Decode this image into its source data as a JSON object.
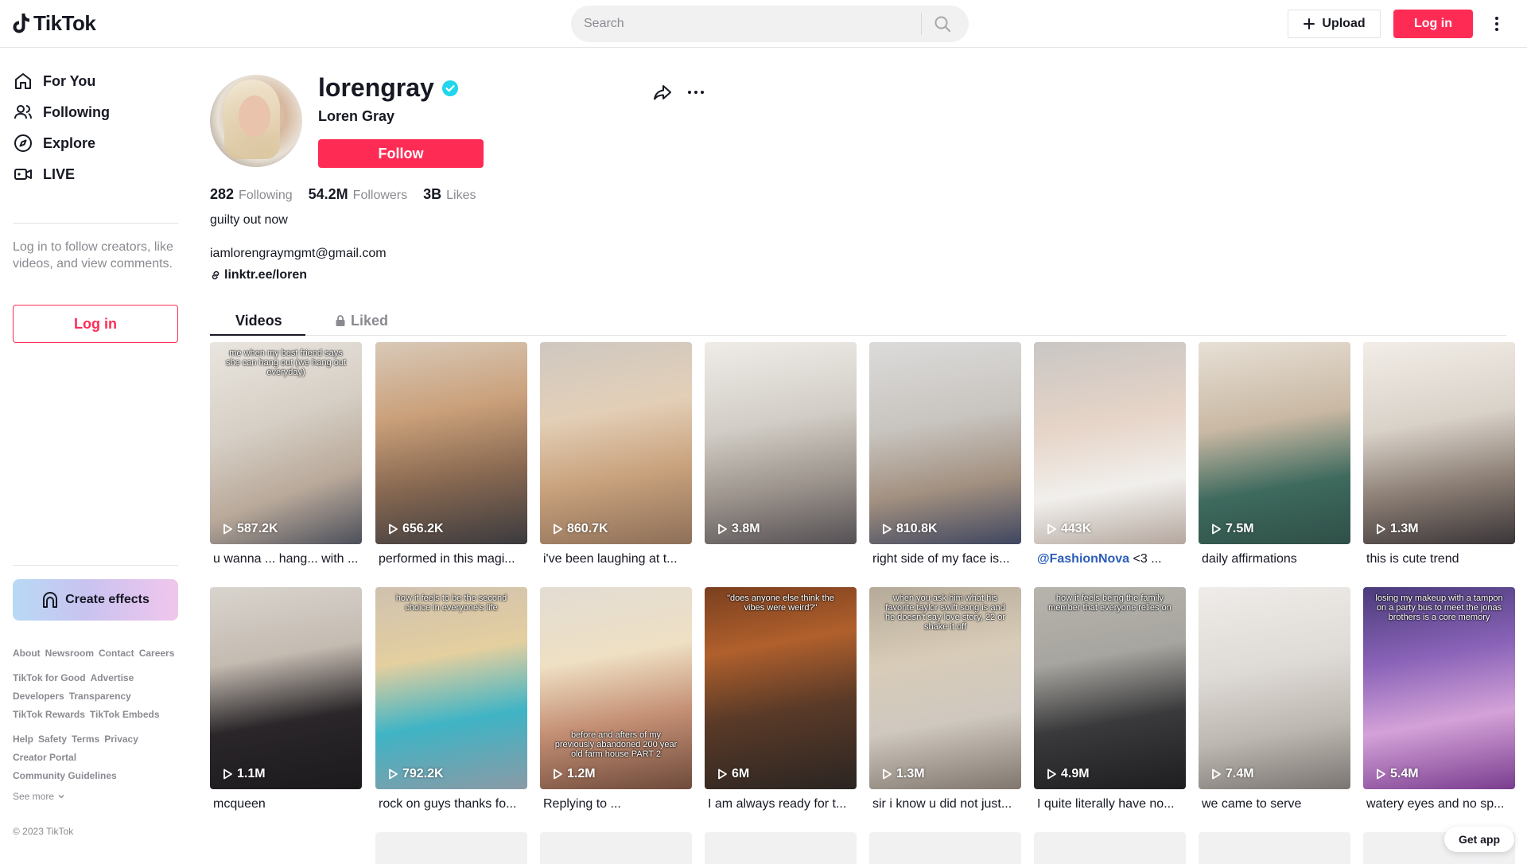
{
  "header": {
    "logo_text": "TikTok",
    "search_placeholder": "Search",
    "upload_label": "Upload",
    "login_label": "Log in"
  },
  "sidebar": {
    "items": [
      {
        "label": "For You",
        "icon": "home-icon"
      },
      {
        "label": "Following",
        "icon": "users-icon"
      },
      {
        "label": "Explore",
        "icon": "compass-icon"
      },
      {
        "label": "LIVE",
        "icon": "live-icon"
      }
    ],
    "login_hint": "Log in to follow creators, like videos, and view comments.",
    "login_label": "Log in",
    "create_effects_label": "Create effects",
    "footer_rows": [
      [
        "About",
        "Newsroom",
        "Contact",
        "Careers"
      ],
      [
        "TikTok for Good",
        "Advertise"
      ],
      [
        "Developers",
        "Transparency"
      ],
      [
        "TikTok Rewards",
        "TikTok Embeds"
      ],
      [
        "Help",
        "Safety",
        "Terms",
        "Privacy"
      ],
      [
        "Creator Portal"
      ],
      [
        "Community Guidelines"
      ]
    ],
    "see_more": "See more",
    "copyright": "© 2023 TikTok"
  },
  "profile": {
    "username": "lorengray",
    "nickname": "Loren Gray",
    "follow_label": "Follow",
    "following_count": "282",
    "following_label": "Following",
    "followers_count": "54.2M",
    "followers_label": "Followers",
    "likes_count": "3B",
    "likes_label": "Likes",
    "bio": "guilty out now",
    "email": "iamlorengraymgmt@gmail.com",
    "link": "linktr.ee/loren"
  },
  "tabs": {
    "videos": "Videos",
    "liked": "Liked"
  },
  "videos": [
    {
      "views": "587.2K",
      "caption": "u wanna ... hang... with ...",
      "overlay": "me when my best friend says she can hang out (we hang out everyday)",
      "bg": "linear-gradient(160deg,#e9e5df 0%,#d6cfc5 40%,#b9a99a 70%,#4c4f5a 100%)"
    },
    {
      "views": "656.2K",
      "caption": "performed in this magi...",
      "overlay": "",
      "bg": "linear-gradient(170deg,#d8c9b8 0%,#caa07a 35%,#8a6a52 65%,#3b3a3e 100%)"
    },
    {
      "views": "860.7K",
      "caption": "i've been laughing at t...",
      "overlay": "",
      "bg": "linear-gradient(170deg,#cfc8c1 0%,#e3cfb7 35%,#c9a27d 65%,#8d6f58 100%)"
    },
    {
      "views": "3.8M",
      "caption": "",
      "overlay": "",
      "bg": "linear-gradient(170deg,#efece8 0%,#d2cdc6 40%,#9b938c 70%,#555054 100%)"
    },
    {
      "views": "810.8K",
      "caption": "right side of my face is...",
      "overlay": "",
      "bg": "linear-gradient(170deg,#dcdbda 0%,#c8c4bf 40%,#a29080 70%,#3f4660 100%)"
    },
    {
      "views": "443K",
      "caption": "@FashionNova <3 ...",
      "overlay": "",
      "bg": "linear-gradient(170deg,#c9c6c4 0%,#e6d4c7 40%,#f1efec 70%,#b4a79e 100%)"
    },
    {
      "views": "7.5M",
      "caption": "daily affirmations",
      "overlay": "",
      "bg": "linear-gradient(170deg,#e7e0d6 0%,#c9b8a3 40%,#3e6a5e 70%,#2f4f47 100%)"
    },
    {
      "views": "1.3M",
      "caption": "this is cute trend",
      "overlay": "",
      "bg": "linear-gradient(170deg,#f2ede7 0%,#d9d2c9 40%,#8a7d73 70%,#3a3538 100%)"
    },
    {
      "views": "1.1M",
      "caption": "mcqueen",
      "overlay": "",
      "bg": "linear-gradient(170deg,#d9d4ce 0%,#c4bbb1 35%,#2a2629 65%,#1c1a1d 100%)"
    },
    {
      "views": "792.2K",
      "caption": "rock on guys thanks fo...",
      "overlay": "how it feels to be the second choice in everyone's life",
      "bg": "linear-gradient(170deg,#cfc1b0 0%,#e4cf9f 35%,#3fb4c5 65%,#8a9aa6 100%)"
    },
    {
      "views": "1.2M",
      "caption": "Replying to ...",
      "overlay": "before and afters of my previously abandoned 200 year old farm house PART 2",
      "bg": "linear-gradient(170deg,#e2dcd3 0%,#efe0c4 35%,#c48f74 65%,#6e4a3b 100%)"
    },
    {
      "views": "6M",
      "caption": "I am always ready for t...",
      "overlay": "\"does anyone else think the vibes were weird?\"",
      "bg": "linear-gradient(170deg,#7a3f1f 0%,#b0602c 30%,#5a3a28 60%,#2b2522 100%)"
    },
    {
      "views": "1.3M",
      "caption": "sir i know u did not just...",
      "overlay": "when you ask him what his favorite taylor swift song is and he doesn't say love story, 22 or shake it off",
      "bg": "linear-gradient(170deg,#b5aa99 0%,#d8ccb8 35%,#cfc8bf 65%,#80766d 100%)"
    },
    {
      "views": "4.9M",
      "caption": "I quite literally have no...",
      "overlay": "how it feels being the family member that everyone relies on",
      "bg": "linear-gradient(170deg,#b7b4ad 0%,#a7a59f 35%,#3a3a3c 65%,#1e1e20 100%)"
    },
    {
      "views": "7.4M",
      "caption": "we came to serve",
      "overlay": "",
      "bg": "linear-gradient(170deg,#efece9 0%,#dedad5 40%,#bdb7b1 70%,#7a7571 100%)"
    },
    {
      "views": "5.4M",
      "caption": "watery eyes and no sp...",
      "overlay": "losing my makeup with a tampon on a party bus to meet the jonas brothers is a core memory",
      "bg": "linear-gradient(170deg,#4a3b7a 0%,#8a63b8 35%,#d4a2d8 65%,#7a3d8f 100%)"
    }
  ],
  "get_app": "Get app"
}
